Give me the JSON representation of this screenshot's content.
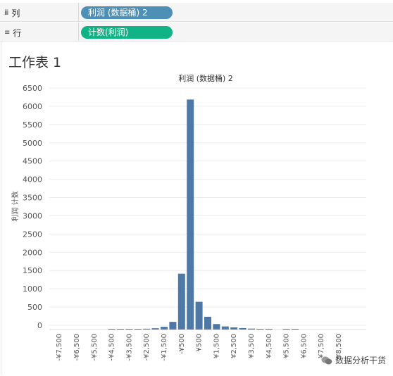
{
  "shelves": {
    "columns": {
      "icon": "columns-icon",
      "label": "列",
      "pill": "利润 (数据桶) 2",
      "pill_color": "#4e8fb6"
    },
    "rows": {
      "icon": "rows-icon",
      "label": "行",
      "pill": "计数(利润)",
      "pill_color": "#0fb386"
    }
  },
  "sheet": {
    "title": "工作表 1"
  },
  "watermark": {
    "text": "数据分析干货"
  },
  "chart_data": {
    "type": "bar",
    "title": "利润 (数据桶) 2",
    "xlabel": "",
    "ylabel": "利润 计数",
    "bar_color": "#4e79a7",
    "ylim": [
      0,
      6500
    ],
    "yticks": [
      0,
      500,
      1000,
      1500,
      2000,
      2500,
      3000,
      3500,
      4000,
      4500,
      5000,
      5500,
      6000,
      6500
    ],
    "xtick_labels": [
      "-¥7,500",
      "-¥6,500",
      "-¥5,500",
      "-¥4,500",
      "-¥3,500",
      "-¥2,500",
      "-¥1,500",
      "-¥500",
      "¥500",
      "¥1,500",
      "¥2,500",
      "¥3,500",
      "¥4,500",
      "¥5,500",
      "¥6,500",
      "¥7,500",
      "¥8,500"
    ],
    "bins": [
      -7500,
      -7000,
      -6500,
      -6000,
      -5500,
      -5000,
      -4500,
      -4000,
      -3500,
      -3000,
      -2500,
      -2000,
      -1500,
      -1000,
      -500,
      0,
      500,
      1000,
      1500,
      2000,
      2500,
      3000,
      3500,
      4000,
      4500,
      5000,
      5500,
      6000,
      6500,
      7000,
      7500,
      8000,
      8500
    ],
    "values": [
      0,
      0,
      0,
      0,
      0,
      0,
      3,
      4,
      5,
      18,
      22,
      35,
      75,
      210,
      1530,
      6300,
      760,
      350,
      150,
      85,
      60,
      40,
      25,
      12,
      6,
      0,
      10,
      5,
      0,
      0,
      0,
      0,
      0
    ],
    "grid": true
  }
}
